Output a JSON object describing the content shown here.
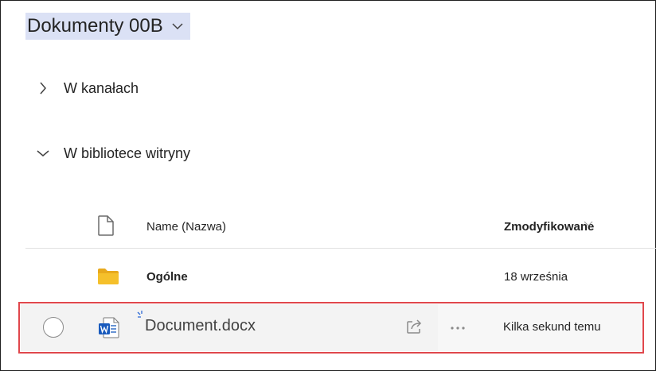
{
  "library": {
    "title": "Dokumenty 00B",
    "dropdown_icon": "chevron-down-icon"
  },
  "sections": [
    {
      "label": "W kanałach",
      "expanded": false,
      "icon": "chevron-right-icon"
    },
    {
      "label": "W bibliotece witryny",
      "expanded": true,
      "icon": "chevron-down-icon"
    }
  ],
  "columns": {
    "file_type_icon": "file-icon",
    "name_label": "Name (Nazwa)",
    "modified_label": "Zmodyfikowane"
  },
  "rows": [
    {
      "type": "folder",
      "icon": "folder-icon",
      "name": "Ogólne",
      "modified": "18 września"
    },
    {
      "type": "word",
      "icon": "word-document-icon",
      "name": "Document.docx",
      "modified": "Kilka sekund temu",
      "is_new": true,
      "highlighted": true
    }
  ],
  "colors": {
    "title_highlight": "#dbe1f5",
    "folder": "#f5c02b",
    "word_blue": "#185abd",
    "highlight_border": "#e0474c",
    "new_mark": "#2f6bd6"
  }
}
